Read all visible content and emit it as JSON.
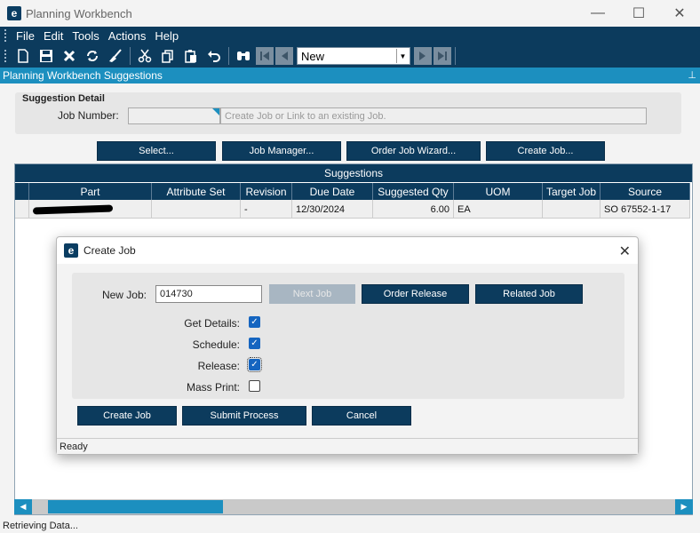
{
  "window": {
    "title": "Planning Workbench",
    "logo_letter": "e",
    "min_glyph": "—",
    "max_glyph": "☐",
    "close_glyph": "✕"
  },
  "menu": {
    "items": [
      "File",
      "Edit",
      "Tools",
      "Actions",
      "Help"
    ]
  },
  "toolbar": {
    "icons": [
      "new-icon",
      "save-icon",
      "delete-icon",
      "refresh-icon",
      "clear-icon",
      "cut-icon",
      "copy-icon",
      "paste-icon",
      "undo-icon",
      "search-icon"
    ],
    "record_select_value": "New"
  },
  "panel": {
    "caption": "Planning Workbench Suggestions"
  },
  "suggestion_detail": {
    "heading": "Suggestion Detail",
    "job_number_label": "Job Number:",
    "job_number_value": "",
    "link_hint": "Create Job or Link to an existing Job."
  },
  "actions": {
    "select": "Select...",
    "job_manager": "Job Manager...",
    "order_job_wizard": "Order Job Wizard...",
    "create_job": "Create Job..."
  },
  "grid": {
    "title": "Suggestions",
    "columns": [
      "Part",
      "Attribute Set",
      "Revision",
      "Due Date",
      "Suggested Qty",
      "UOM",
      "Target Job",
      "Source"
    ],
    "rows": [
      {
        "part": "",
        "attribute_set": "",
        "revision": "-",
        "due_date": "12/30/2024",
        "suggested_qty": "6.00",
        "uom": "EA",
        "target_job": "",
        "source": "SO 67552-1-17"
      }
    ]
  },
  "status": {
    "text": "Retrieving Data..."
  },
  "dialog": {
    "title": "Create Job",
    "close_glyph": "✕",
    "new_job_label": "New Job:",
    "new_job_value": "014730",
    "next_job": "Next Job",
    "order_release": "Order Release",
    "related_job": "Related Job",
    "get_details_label": "Get Details:",
    "schedule_label": "Schedule:",
    "release_label": "Release:",
    "mass_print_label": "Mass Print:",
    "get_details_checked": true,
    "schedule_checked": true,
    "release_checked": true,
    "mass_print_checked": false,
    "create_job_btn": "Create Job",
    "submit_process_btn": "Submit Process",
    "cancel_btn": "Cancel",
    "status": "Ready"
  }
}
